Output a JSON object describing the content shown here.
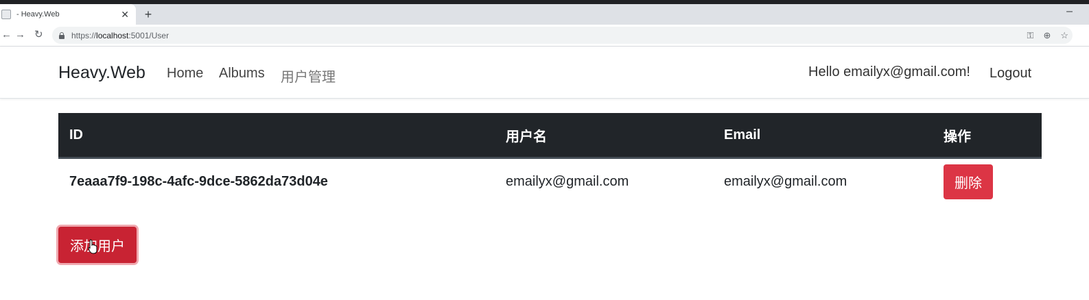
{
  "browser": {
    "tab_title": "- Heavy.Web",
    "url_prefix": "https://",
    "url_host": "localhost",
    "url_rest": ":5001/User"
  },
  "navbar": {
    "brand": "Heavy.Web",
    "links": [
      "Home",
      "Albums",
      "用户管理"
    ],
    "greeting": "Hello emailyx@gmail.com!",
    "logout": "Logout"
  },
  "table": {
    "headers": [
      "ID",
      "用户名",
      "Email",
      "操作"
    ],
    "rows": [
      {
        "id": "7eaaa7f9-198c-4afc-9dce-5862da73d04e",
        "username": "emailyx@gmail.com",
        "email": "emailyx@gmail.com",
        "action": "删除"
      }
    ]
  },
  "add_button": "添加用户",
  "colors": {
    "navbar_dark": "#212529",
    "danger": "#dc3545"
  },
  "icons": [
    "favicon-icon",
    "close-tab-icon",
    "new-tab-icon",
    "minimize-icon",
    "back-icon",
    "forward-icon",
    "reload-icon",
    "lock-icon",
    "key-icon",
    "zoom-icon",
    "star-icon",
    "cursor-icon"
  ]
}
